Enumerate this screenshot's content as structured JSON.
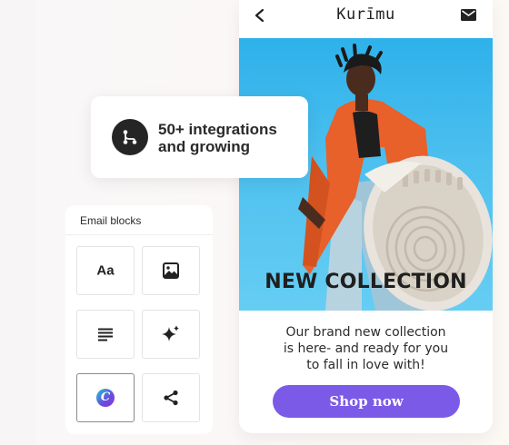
{
  "email_preview": {
    "brand": "Kurīmu",
    "hero_title": "NEW COLLECTION",
    "description_lines": [
      "Our brand new collection",
      "is here- and ready for you",
      "to fall in love with!"
    ],
    "cta_label": "Shop now",
    "cta_color": "#7b5ae8",
    "hero_sky_color": "#2eb1ea"
  },
  "integrations": {
    "lines": [
      "50+ integrations",
      "and growing"
    ],
    "icon": "branch-flow-icon"
  },
  "email_blocks": {
    "title": "Email blocks",
    "tiles": [
      {
        "icon": "text-icon",
        "label": "Aa"
      },
      {
        "icon": "image-icon"
      },
      {
        "icon": "paragraph-lines-icon"
      },
      {
        "icon": "sparkle-icon"
      },
      {
        "icon": "canva-icon",
        "label": "C",
        "selected": true
      },
      {
        "icon": "share-icon"
      }
    ]
  }
}
